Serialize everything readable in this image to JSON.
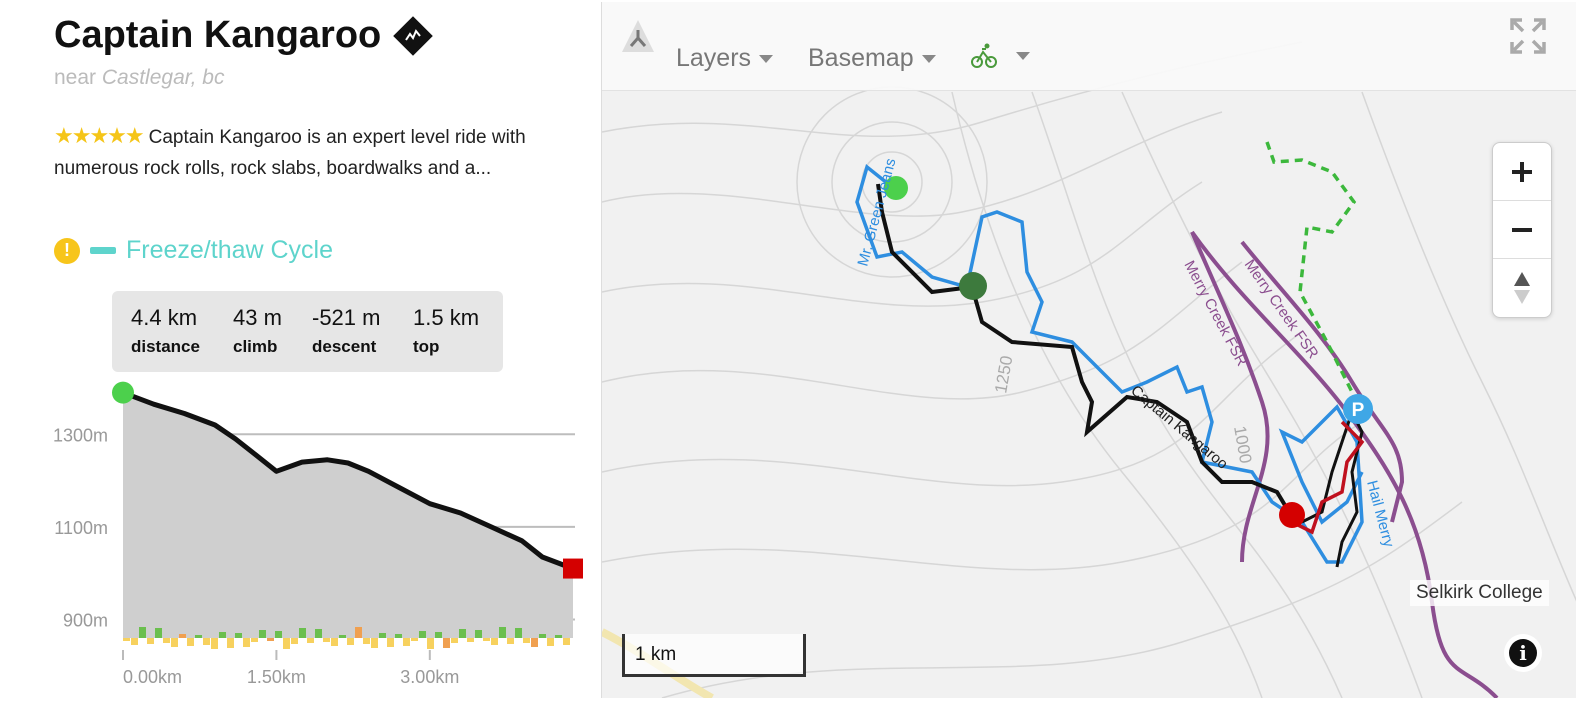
{
  "trail": {
    "title": "Captain Kangaroo",
    "difficulty_icon": "black-diamond-icon",
    "near_prefix": "near",
    "near_place": "Castlegar, bc",
    "rating_stars": "★★★★★",
    "description": "Captain Kangaroo is an expert level ride with numerous rock rolls, rock slabs, boardwalks and a...",
    "condition": "Freeze/thaw Cycle",
    "condition_color": "#5ed4cc"
  },
  "stats": [
    {
      "value": "4.4 km",
      "label": "distance"
    },
    {
      "value": "43 m",
      "label": "climb"
    },
    {
      "value": "-521 m",
      "label": "descent"
    },
    {
      "value": "1.5 km",
      "label": "top"
    }
  ],
  "chart_data": {
    "type": "area",
    "x_ticks": [
      "0.00km",
      "1.50km",
      "3.00km"
    ],
    "y_ticks": [
      "1300m",
      "1100m",
      "900m"
    ],
    "xlim": [
      0,
      4.4
    ],
    "ylim": [
      860,
      1400
    ],
    "series": [
      {
        "x": [
          0,
          0.3,
          0.6,
          0.9,
          1.1,
          1.3,
          1.5,
          1.75,
          2.0,
          2.2,
          2.4,
          2.7,
          3.0,
          3.3,
          3.6,
          3.9,
          4.1,
          4.4
        ],
        "y": [
          1390,
          1365,
          1345,
          1320,
          1290,
          1255,
          1220,
          1240,
          1245,
          1238,
          1220,
          1185,
          1150,
          1130,
          1100,
          1070,
          1035,
          1010
        ]
      }
    ],
    "grade_bar_colors": [
      "#6bbf4e",
      "#f7d15e",
      "#f0a050"
    ]
  },
  "map": {
    "layers_label": "Layers",
    "basemap_label": "Basemap",
    "activity_icon": "bike-icon",
    "scale_label": "1 km",
    "place_label": "Selkirk College",
    "trail_labels": [
      "Captain Kangaroo",
      "Mr. Green Jeans",
      "Merry Creek FSR",
      "Merry Creek FSR",
      "Hail Merry"
    ],
    "contour_labels": [
      "1250",
      "1000"
    ],
    "parking_label": "P"
  }
}
